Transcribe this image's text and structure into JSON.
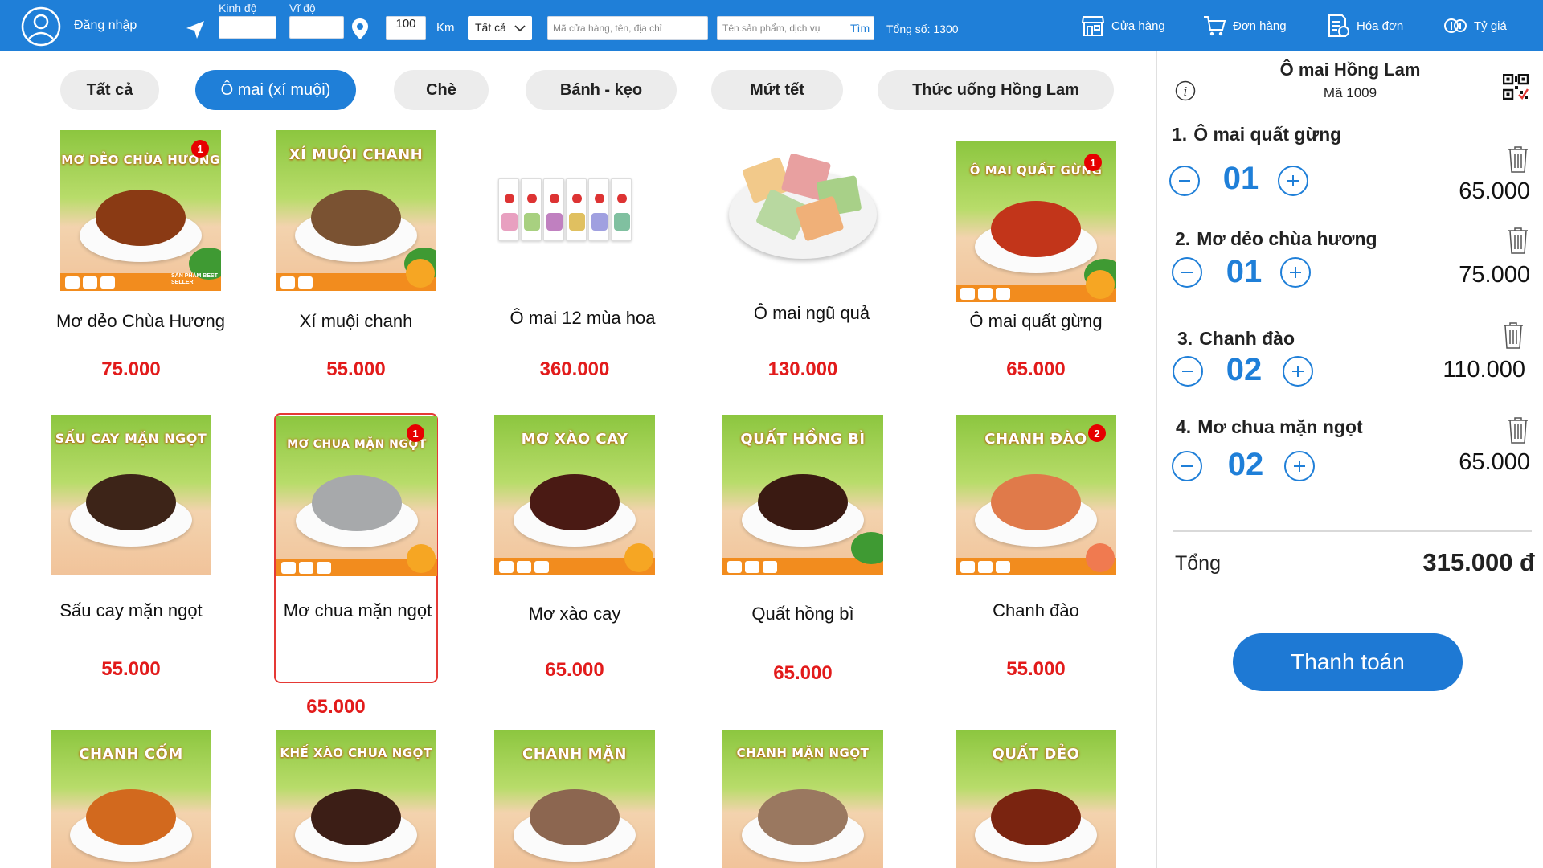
{
  "topbar": {
    "login_label": "Đăng nhập",
    "longitude_label": "Kinh độ",
    "latitude_label": "Vĩ độ",
    "longitude_value": "",
    "latitude_value": "",
    "radius_value": "100",
    "radius_unit": "Km",
    "category_selected": "Tất cả",
    "store_search_placeholder": "Mã cửa hàng, tên, địa chỉ",
    "product_search_placeholder": "Tên sản phẩm, dịch vụ",
    "find_label": "Tìm",
    "total_count": "Tổng số: 1300",
    "nav": [
      {
        "label": "Cửa hàng",
        "icon": "store-icon"
      },
      {
        "label": "Đơn hàng",
        "icon": "cart-icon"
      },
      {
        "label": "Hóa đơn",
        "icon": "invoice-icon"
      },
      {
        "label": "Tỷ giá",
        "icon": "exchange-rate-icon"
      }
    ]
  },
  "tabs": [
    {
      "label": "Tất cả",
      "active": false
    },
    {
      "label": "Ô mai (xí muội)",
      "active": true
    },
    {
      "label": "Chè",
      "active": false
    },
    {
      "label": "Bánh - kẹo",
      "active": false
    },
    {
      "label": "Mứt tết",
      "active": false
    },
    {
      "label": "Thức uống Hồng Lam",
      "active": false
    }
  ],
  "products": [
    {
      "name": "Mơ dẻo Chùa Hương",
      "price": "75.000",
      "image_title": "MƠ DẺO CHÙA HƯƠNG",
      "image_extra": "SẢN PHẨM BEST SELLER",
      "badge": "1",
      "food_color": "#8a3a14"
    },
    {
      "name": "Xí muội chanh",
      "price": "55.000",
      "image_title": "XÍ MUỘI CHANH",
      "badge": "",
      "food_color": "#7a5232"
    },
    {
      "name": "Ô mai 12 mùa hoa",
      "price": "360.000",
      "image_title": "",
      "badge": "",
      "food_color": ""
    },
    {
      "name": "Ô mai ngũ quả",
      "price": "130.000",
      "image_title": "",
      "badge": "",
      "food_color": ""
    },
    {
      "name": "Ô mai quất gừng",
      "price": "65.000",
      "image_title": "Ô MAI QUẤT GỪNG",
      "badge": "1",
      "food_color": "#c2351a"
    },
    {
      "name": "Sấu cay mặn ngọt",
      "price": "55.000",
      "image_title": "SẤU CAY MẶN NGỌT",
      "badge": "",
      "food_color": "#3d2418"
    },
    {
      "name": "Mơ chua mặn ngọt",
      "price": "65.000",
      "image_title": "MƠ CHUA MẶN NGỌT",
      "badge": "1",
      "food_color": "#a7a9ab"
    },
    {
      "name": "Mơ xào cay",
      "price": "65.000",
      "image_title": "MƠ XÀO CAY",
      "badge": "",
      "food_color": "#4a1a14"
    },
    {
      "name": "Quất hồng bì",
      "price": "65.000",
      "image_title": "QUẤT HỒNG BÌ",
      "badge": "",
      "food_color": "#3a1a12"
    },
    {
      "name": "Chanh đào",
      "price": "55.000",
      "image_title": "CHANH ĐÀO",
      "badge": "2",
      "food_color": "#e07a4a"
    },
    {
      "name": "",
      "price": "",
      "image_title": "CHANH CỐM",
      "badge": "",
      "food_color": "#d2691e"
    },
    {
      "name": "",
      "price": "",
      "image_title": "KHẾ XÀO CHUA NGỌT",
      "badge": "",
      "food_color": "#3c1e16"
    },
    {
      "name": "",
      "price": "",
      "image_title": "CHANH MẶN",
      "badge": "",
      "food_color": "#8c6650"
    },
    {
      "name": "",
      "price": "",
      "image_title": "CHANH MẶN NGỌT",
      "badge": "",
      "food_color": "#9a7860"
    },
    {
      "name": "",
      "price": "",
      "image_title": "QUẤT DẺO",
      "badge": "",
      "food_color": "#7a2410"
    }
  ],
  "cart": {
    "shop_name": "Ô mai  Hồng Lam",
    "shop_code": "Mã 1009",
    "items": [
      {
        "index": "1.",
        "name": "Ô mai quất gừng",
        "qty": "01",
        "price": "65.000"
      },
      {
        "index": "2.",
        "name": "Mơ dẻo chùa hương",
        "qty": "01",
        "price": "75.000"
      },
      {
        "index": "3.",
        "name": "Chanh đào",
        "qty": "02",
        "price": "110.000"
      },
      {
        "index": "4.",
        "name": "Mơ chua mặn ngọt",
        "qty": "02",
        "price": "65.000"
      }
    ],
    "total_label": "Tổng",
    "total_value": "315.000 đ",
    "pay_label": "Thanh toán"
  }
}
